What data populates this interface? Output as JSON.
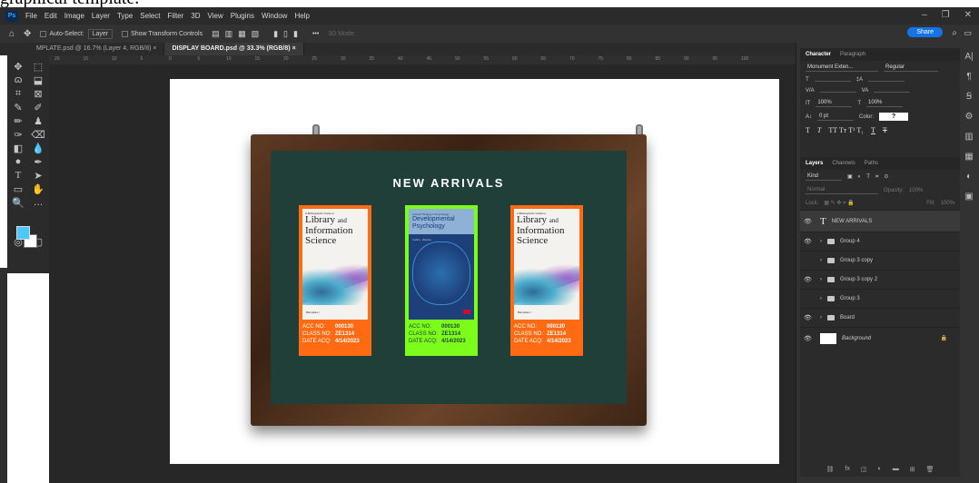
{
  "caption": "graphical template.",
  "menu": {
    "logo": "Ps",
    "items": [
      "File",
      "Edit",
      "Image",
      "Layer",
      "Type",
      "Select",
      "Filter",
      "3D",
      "View",
      "Plugins",
      "Window",
      "Help"
    ]
  },
  "options": {
    "auto_select": "Auto-Select:",
    "layer_select": "Layer",
    "show_transform": "Show Transform Controls",
    "more": "•••",
    "mode_3d": "3D Mode:",
    "share": "Share"
  },
  "tabs": [
    {
      "label": "MPLATE.psd @ 16.7% (Layer 4, RGB/8)",
      "close": "×"
    },
    {
      "label": "DISPLAY BOARD.psd @ 33.3% (RGB/8)",
      "close": "×"
    }
  ],
  "ruler_marks": [
    "20",
    "15",
    "10",
    "5",
    "0",
    "5",
    "10",
    "15",
    "20",
    "25",
    "30",
    "35",
    "40",
    "45",
    "50",
    "55",
    "60",
    "65",
    "70",
    "75",
    "80",
    "85",
    "90",
    "95",
    "100"
  ],
  "board": {
    "heading": "NEW ARRIVALS",
    "books": [
      {
        "series": "A Bibliographic Guide to",
        "title_a": "Library",
        "title_and": "and",
        "title_b": "Information",
        "title_c": "Science",
        "author": "Barnabas I.",
        "acc_label": "ACC NO:",
        "acc": "000130",
        "class_label": "CLASS NO:",
        "class_no": "ZE1314",
        "date_label": "DATE ACQ:",
        "date": "4/14/2023"
      },
      {
        "series": "Critical Thinking in Psychology",
        "title_a": "Developmental",
        "title_b": "Psychology",
        "author": "Cahil L. Weston",
        "acc_label": "ACC NO:",
        "acc": "000130",
        "class_label": "CLASS NO:",
        "class_no": "ZE1314",
        "date_label": "DATE ACQ:",
        "date": "4/14/2023"
      },
      {
        "series": "A Bibliographic Guide to",
        "title_a": "Library",
        "title_and": "and",
        "title_b": "Information",
        "title_c": "Science",
        "author": "Barnabas I.",
        "acc_label": "ACC NO:",
        "acc": "000130",
        "class_label": "CLASS NO:",
        "class_no": "ZE1314",
        "date_label": "DATE ACQ:",
        "date": "4/14/2023"
      }
    ]
  },
  "character": {
    "tabs": [
      "Character",
      "Paragraph"
    ],
    "font": "Monument Exten...",
    "style": "Regular",
    "scale_v": "100%",
    "scale_h": "100%",
    "baseline": "0 pt",
    "color_label": "Color:",
    "color_value": "?"
  },
  "layers": {
    "tabs": [
      "Layers",
      "Channels",
      "Paths"
    ],
    "kind": "Kind",
    "blend": "Normal",
    "opacity_label": "Opacity:",
    "opacity": "100%",
    "lock_label": "Lock:",
    "fill_label": "Fill:",
    "fill": "100%",
    "items": [
      {
        "name": "NEW ARRIVALS",
        "type": "text"
      },
      {
        "name": "Group 4",
        "type": "group"
      },
      {
        "name": "Group 3 copy",
        "type": "group"
      },
      {
        "name": "Group 3 copy 2",
        "type": "group"
      },
      {
        "name": "Group 3",
        "type": "group"
      },
      {
        "name": "Board",
        "type": "group"
      },
      {
        "name": "Background",
        "type": "background"
      }
    ],
    "bottom_icons": [
      "fx"
    ]
  },
  "colors": {
    "accent": "#1473e6",
    "card_orange": "#ff6a13",
    "card_green": "#7cfc1a",
    "board": "#1f3f38",
    "foreground_swatch": "#4cc8ff"
  }
}
